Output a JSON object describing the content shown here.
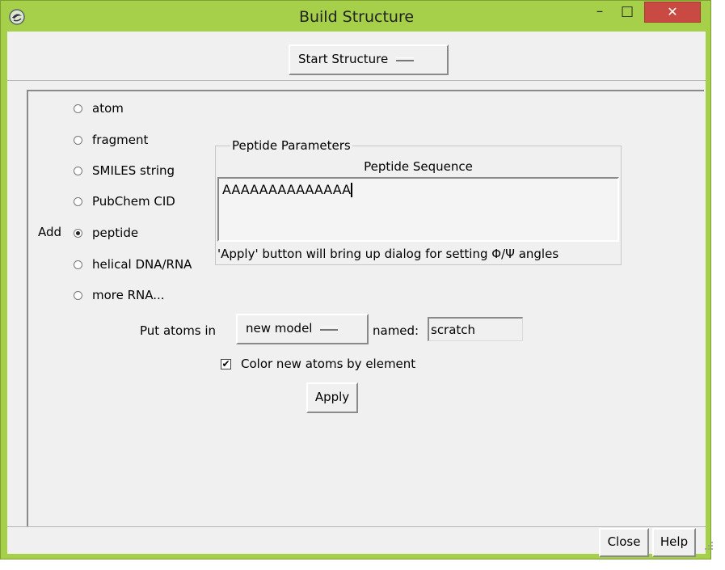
{
  "window": {
    "title": "Build Structure",
    "min_glyph": "–",
    "max_glyph": "□",
    "close_glyph": "✕"
  },
  "topbar": {
    "start_structure_label": "Start Structure"
  },
  "add": {
    "label": "Add",
    "options": [
      {
        "label": "atom",
        "selected": false
      },
      {
        "label": "fragment",
        "selected": false
      },
      {
        "label": "SMILES string",
        "selected": false
      },
      {
        "label": "PubChem CID",
        "selected": false
      },
      {
        "label": "peptide",
        "selected": true
      },
      {
        "label": "helical DNA/RNA",
        "selected": false
      },
      {
        "label": "more RNA...",
        "selected": false
      }
    ]
  },
  "peptide_params": {
    "legend": "Peptide Parameters",
    "sequence_label": "Peptide Sequence",
    "sequence_value": "AAAAAAAAAAAAAA",
    "hint": "'Apply' button will bring up dialog for setting Φ/Ψ angles"
  },
  "put_atoms": {
    "label": "Put atoms in",
    "model_value": "new model",
    "named_label": "named:",
    "named_value": "scratch"
  },
  "color_by_element": {
    "label": "Color new atoms by element",
    "checked": true,
    "check_glyph": "✔"
  },
  "buttons": {
    "apply": "Apply",
    "close": "Close",
    "help": "Help"
  }
}
